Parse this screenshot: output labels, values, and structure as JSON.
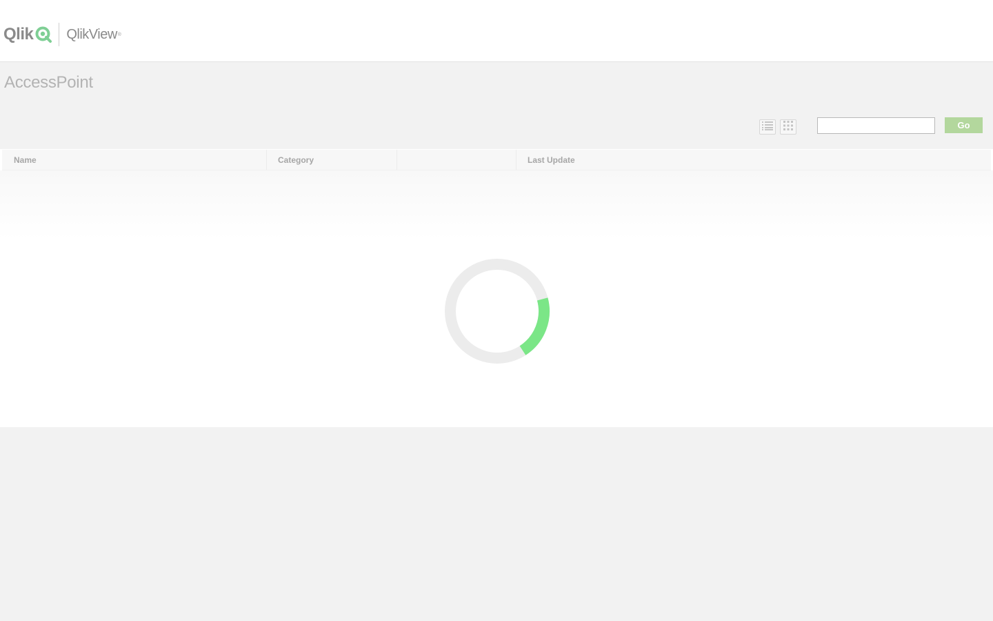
{
  "header": {
    "logo_text": "Qlik",
    "product_name": "QlikView",
    "product_mark": "®"
  },
  "page": {
    "title": "AccessPoint"
  },
  "toolbar": {
    "list_view_icon": "list-view-icon",
    "grid_view_icon": "grid-view-icon",
    "search": {
      "value": "",
      "placeholder": ""
    },
    "go_label": "Go"
  },
  "table": {
    "columns": [
      "Name",
      "Category",
      "",
      "Last Update"
    ],
    "rows": []
  },
  "loading": {
    "state": "loading",
    "icon": "loading-spinner",
    "progress": 0.2
  },
  "colors": {
    "accent": "#7be687",
    "go_button": "#b3d79d",
    "logo_mark": "#7fcf95",
    "background": "#f2f2f2"
  }
}
